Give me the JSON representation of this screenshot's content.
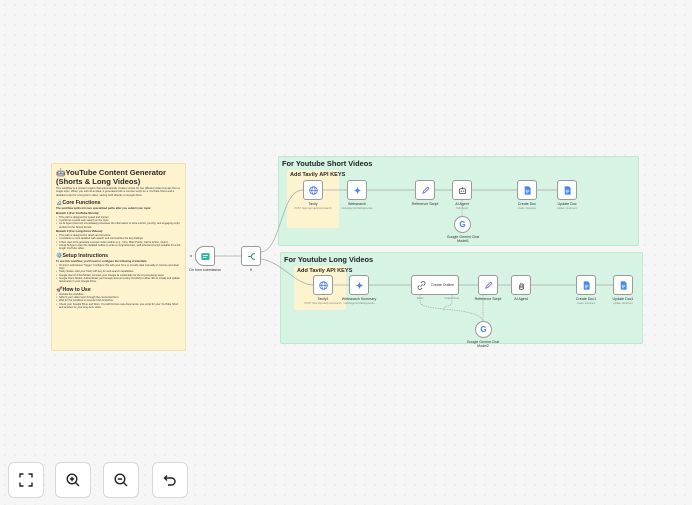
{
  "note": {
    "title": "🤖YouTube Content Generator (Shorts & Long Videos)",
    "intro": "This workflow is a content engine that automatically creates scripts for two different video formats from a single topic. When you submit an idea, it generates both a concise script for a YouTube Short and a detailed script for a long-form video, saving both directly to Google Docs.",
    "core_heading": "🔬Core Functions",
    "core_sub": "The workflow splits into two specialized paths after you submit your topic:",
    "branch1_heading": "Branch 1 (For YouTube Shorts):",
    "branch1_items": [
      "This path is designed for speed and impact.",
      "It performs a quick web search on the topic.",
      "An AI Agent (Gemini) immediately processes the information to write a short, punchy, and engaging script perfect for the Shorts format."
    ],
    "branch2_heading": "Branch 2 (For Long-Form Videos):",
    "branch2_items": [
      "This path is designed for depth and structure.",
      "It conducts a more detailed web search and summarizes the key findings.",
      "It then uses AI to generate a proper video outline (e.g., Intro, Main Points, Call to Action, Outro).",
      "A final AI Agent uses this detailed outline to write a comprehensive, well-structured script suitable for a full-length YouTube video."
    ],
    "setup_heading": "⚙️Setup Instructions",
    "setup_sub": "To use this workflow, you'll need to configure the following credentials:",
    "setup_items": [
      "On Form submission Trigger: Configure this with your form or provide data manually in concise and clear topic.",
      "Tavily Nodes: Add your Tavily API key for web search capabilities.",
      "Google Gemini Chat Model: Connect your Google AI credentials for the AI processing steps.",
      "Google Docs Nodes: Authenticate your Google account (using OAuth2) to allow n8n to create and update documents in your Google Drive."
    ],
    "howto_heading": "🚀How to Use",
    "howto_items": [
      "Activate the workflow.",
      "Submit your video topic through the connected form.",
      "Wait for the workflow to execute both branches.",
      "Check your Google Drive and Docs. You will find two new documents: one script for your YouTube Short and another for your long-form video."
    ]
  },
  "trigger": {
    "form_label": "On form submission",
    "split_label": "If"
  },
  "short_group": {
    "title": "For Youtube Short Videos",
    "apikey_title": "Add Tavily API KEYS",
    "nodes": [
      {
        "label": "Tavily",
        "sub": "POST: https://api.tavily.com/search",
        "icon": "globe-icon"
      },
      {
        "label": "Websearch",
        "sub": "models/gemini-flash/generate",
        "icon": "sparkle-icon"
      },
      {
        "label": "Reference Script",
        "sub": "",
        "icon": "pencil-icon"
      },
      {
        "label": "AI Agent",
        "sub": "Tools Agent",
        "icon": "robot-icon"
      },
      {
        "label": "Create Doc",
        "sub": "create: document",
        "icon": "doc-icon"
      },
      {
        "label": "Update Doc",
        "sub": "update: document",
        "icon": "doc-icon"
      }
    ],
    "model": {
      "label": "Google Gemini Chat",
      "label2": "Model1"
    }
  },
  "long_group": {
    "title": "For Youtube Long Videos",
    "apikey_title": "Add Tavily API KEYS",
    "nodes": [
      {
        "label": "Tavily1",
        "sub": "POST: https://api.tavily.com/search",
        "icon": "globe-icon"
      },
      {
        "label": "Websearch Summary",
        "sub": "models/gemini-flash/generate",
        "icon": "sparkle-icon"
      },
      {
        "label": "Create Outline",
        "sub": "",
        "icon": "link-icon"
      },
      {
        "label": "Reference Script",
        "sub": "",
        "icon": "pencil-icon"
      },
      {
        "label": "AI Agent",
        "sub": "",
        "icon": "hand-icon"
      },
      {
        "label": "Create Doc1",
        "sub": "create: document",
        "icon": "doc-icon"
      },
      {
        "label": "Update Doc1",
        "sub": "update: document",
        "icon": "doc-icon"
      }
    ],
    "outline_ports": [
      "Model",
      "Output Parser"
    ],
    "model": {
      "label": "Google Gemini Chat",
      "label2": "Model2"
    }
  },
  "toolbar": [
    {
      "name": "fit-view-button",
      "icon": "fit-view-icon"
    },
    {
      "name": "zoom-in-button",
      "icon": "zoom-in-icon"
    },
    {
      "name": "zoom-out-button",
      "icon": "zoom-out-icon"
    },
    {
      "name": "undo-button",
      "icon": "undo-icon"
    }
  ],
  "colors": {
    "note_bg": "#fdf3cf",
    "group_bg": "#d6f3e3",
    "node_border": "#9a9a9a",
    "accent": "#ff6d5a"
  }
}
